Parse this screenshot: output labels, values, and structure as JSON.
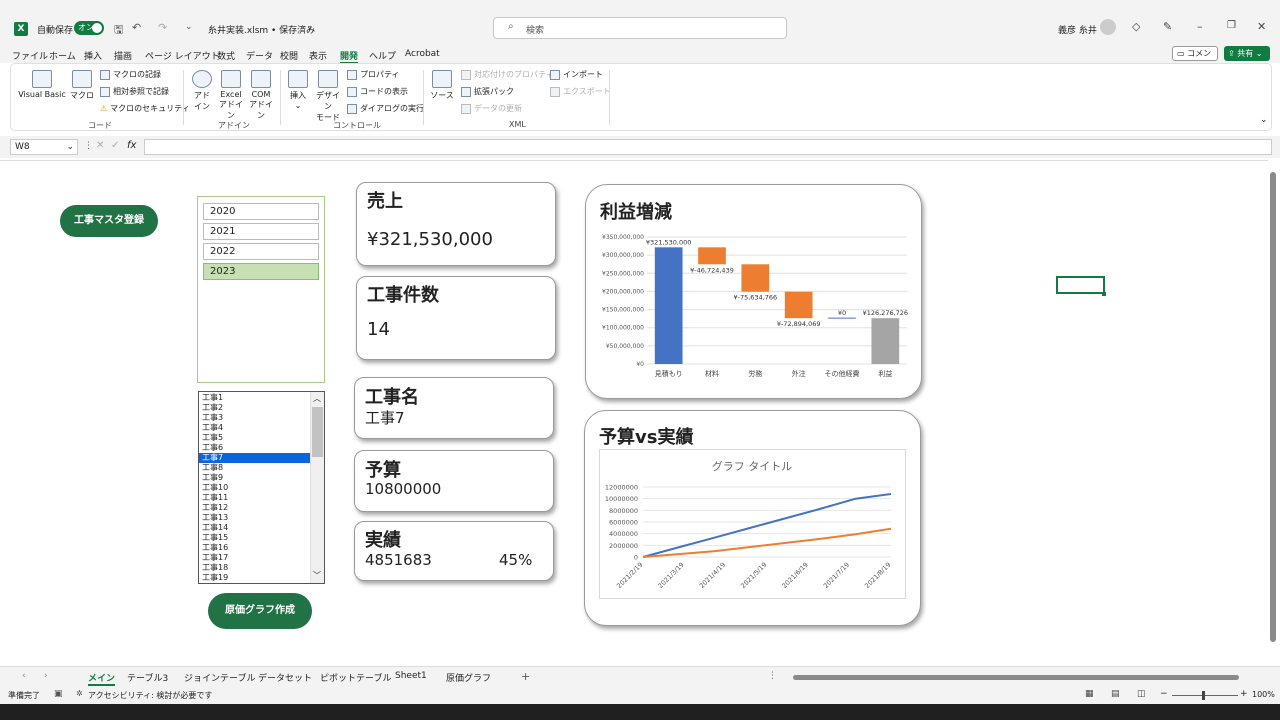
{
  "titlebar": {
    "autosave_label": "自動保存",
    "autosave_state": "オン",
    "filename": "糸井実装.xlsm • 保存済み",
    "search_placeholder": "検索",
    "user": "義彦 糸井"
  },
  "menu": [
    "ファイル",
    "ホーム",
    "挿入",
    "描画",
    "ページ レイアウト",
    "数式",
    "データ",
    "校閲",
    "表示",
    "開発",
    "ヘルプ",
    "Acrobat"
  ],
  "menu_active": "開発",
  "buttons": {
    "comment": "コメント",
    "share": "共有"
  },
  "ribbon": {
    "visual_basic": "Visual Basic",
    "macro": "マクロ",
    "record_macro": "マクロの記録",
    "relative_ref": "相対参照で記録",
    "macro_security": "マクロのセキュリティ",
    "group_code": "コード",
    "addin": "アド\nイン",
    "addin_a": "アド",
    "addin_b": "イン",
    "excel_addin_a": "Excel",
    "excel_addin_b": "アドイン",
    "com_addin_a": "COM",
    "com_addin_b": "アドイン",
    "group_addin": "アドイン",
    "insert": "挿入",
    "design_mode_a": "デザイン",
    "design_mode_b": "モード",
    "properties": "プロパティ",
    "view_code": "コードの表示",
    "run_dialog": "ダイアログの実行",
    "group_control": "コントロール",
    "source": "ソース",
    "map_properties": "対応付けのプロパティ",
    "expansion_pack": "拡張パック",
    "refresh_data": "データの更新",
    "import": "インポート",
    "export": "エクスポート",
    "group_xml": "XML"
  },
  "formula_bar": {
    "name_box": "W8",
    "fx": "fx",
    "value": ""
  },
  "sheet": {
    "master_button": "工事マスタ登録",
    "cost_graph_button": "原価グラフ作成",
    "years": [
      "2020",
      "2021",
      "2022",
      "2023"
    ],
    "selected_year": "2023",
    "projects": [
      "工事1",
      "工事2",
      "工事3",
      "工事4",
      "工事5",
      "工事6",
      "工事7",
      "工事8",
      "工事9",
      "工事10",
      "工事11",
      "工事12",
      "工事13",
      "工事14",
      "工事15",
      "工事16",
      "工事17",
      "工事18",
      "工事19"
    ],
    "selected_project": "工事7",
    "sales": {
      "title": "売上",
      "value": "¥321,530,000"
    },
    "count": {
      "title": "工事件数",
      "value": "14"
    },
    "project_name": {
      "title": "工事名",
      "value": "工事7"
    },
    "budget": {
      "title": "予算",
      "value": "10800000"
    },
    "actual": {
      "title": "実績",
      "value": "4851683",
      "percent": "45%"
    },
    "profit_title": "利益増減",
    "budget_vs_actual_title": "予算vs実績",
    "selected_cell": "W8"
  },
  "chart_data": [
    {
      "type": "bar",
      "subtype": "waterfall",
      "title": "利益増減",
      "categories": [
        "見積もり",
        "材料",
        "労務",
        "外注",
        "その他経費",
        "利益"
      ],
      "values": [
        321530000,
        -46724439,
        -75634766,
        -72894069,
        0,
        126276726
      ],
      "labels": [
        "¥321,530,000",
        "¥-46,724,439",
        "¥-75,634,766",
        "¥-72,894,069",
        "¥0",
        "¥126,276,726"
      ],
      "colors": [
        "#4472c4",
        "#ed7d31",
        "#ed7d31",
        "#ed7d31",
        "#ed7d31",
        "#a5a5a5"
      ],
      "ylim": [
        0,
        350000000
      ],
      "yticks": [
        "¥0",
        "¥50,000,000",
        "¥100,000,000",
        "¥150,000,000",
        "¥200,000,000",
        "¥250,000,000",
        "¥300,000,000",
        "¥350,000,000"
      ],
      "grid": true
    },
    {
      "type": "line",
      "title": "グラフ タイトル",
      "x": [
        "2021/2/19",
        "2021/3/19",
        "2021/4/19",
        "2021/5/19",
        "2021/6/19",
        "2021/7/19",
        "2021/8/19"
      ],
      "series": [
        {
          "values": [
            0,
            1650000,
            3300000,
            4950000,
            6600000,
            8250000,
            10000000,
            10800000
          ],
          "color": "#4472c4"
        },
        {
          "values": [
            0,
            500000,
            1000000,
            1700000,
            2400000,
            3100000,
            3900000,
            4850000
          ],
          "color": "#ed7d31"
        }
      ],
      "ylim": [
        0,
        12000000
      ],
      "yticks": [
        "0",
        "2000000",
        "4000000",
        "6000000",
        "8000000",
        "10000000",
        "12000000"
      ],
      "grid": true
    }
  ],
  "sheet_tabs": [
    "メイン",
    "テーブル3",
    "ジョインテーブル",
    "データセット",
    "ピボットテーブル",
    "Sheet1",
    "原価グラフ"
  ],
  "active_tab": "メイン",
  "status": {
    "ready": "準備完了",
    "accessibility": "アクセシビリティ: 検討が必要です",
    "zoom": "100%"
  }
}
